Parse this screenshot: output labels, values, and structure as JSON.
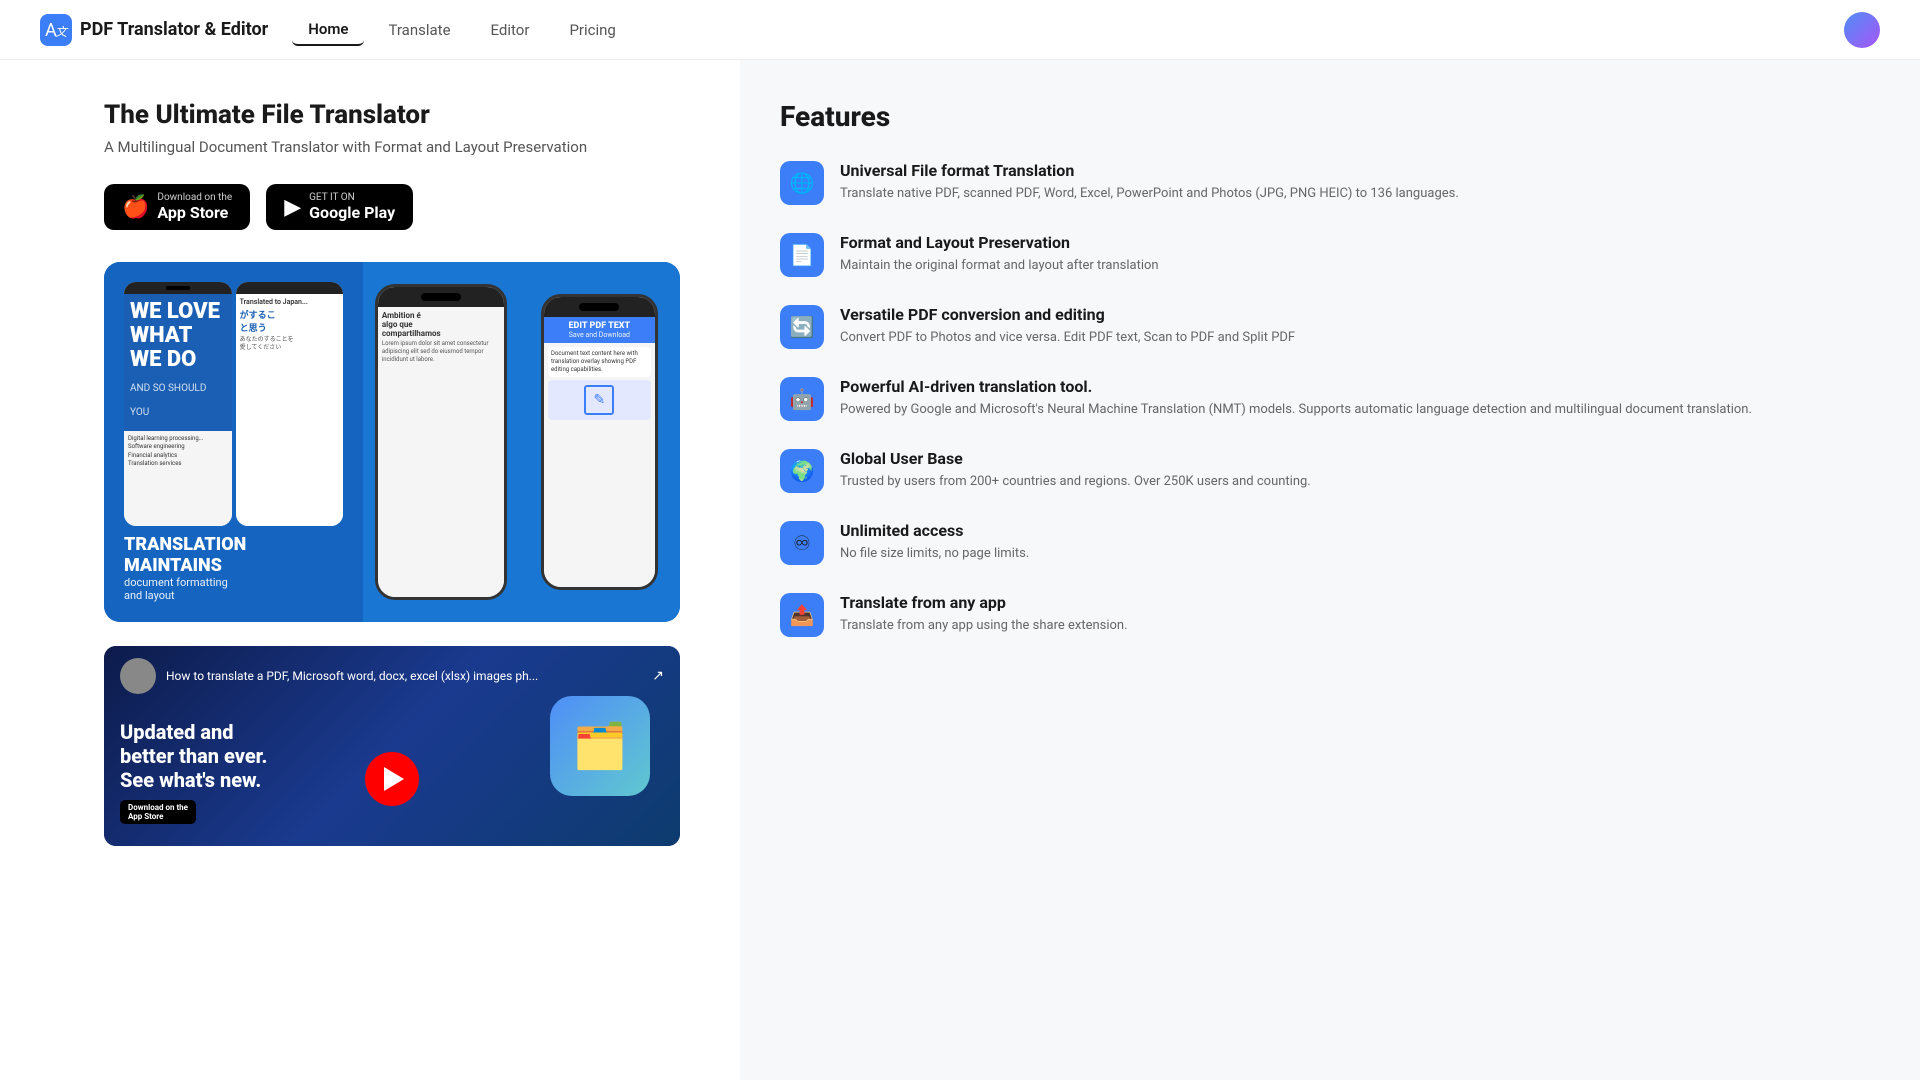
{
  "header": {
    "logo_text": "PDF Translator & Editor",
    "nav": [
      {
        "id": "home",
        "label": "Home",
        "active": true
      },
      {
        "id": "translate",
        "label": "Translate",
        "active": false
      },
      {
        "id": "editor",
        "label": "Editor",
        "active": false
      },
      {
        "id": "pricing",
        "label": "Pricing",
        "active": false
      }
    ]
  },
  "hero": {
    "title": "The Ultimate File Translator",
    "subtitle": "A Multilingual Document Translator with Format and Layout Preservation",
    "app_store_small": "Download on the",
    "app_store_large": "App Store",
    "google_play_small": "GET IT ON",
    "google_play_large": "Google Play"
  },
  "video": {
    "title": "How to translate a PDF, Microsoft word, docx, excel (xlsx) images ph...",
    "main_text": "Updated and\nbetter than\never.\nSee what's new.",
    "download_label": "Download on the\nApp Store",
    "share_icon": "↗"
  },
  "features": {
    "title": "Features",
    "items": [
      {
        "id": "universal",
        "icon": "🌐",
        "name": "Universal File format Translation",
        "desc": "Translate native PDF, scanned PDF, Word, Excel, PowerPoint and Photos (JPG, PNG HEIC) to 136 languages."
      },
      {
        "id": "format",
        "icon": "📄",
        "name": "Format and Layout Preservation",
        "desc": "Maintain the original format and layout after translation"
      },
      {
        "id": "versatile",
        "icon": "🔄",
        "name": "Versatile PDF conversion and editing",
        "desc": "Convert PDF to Photos and vice versa. Edit PDF text, Scan to PDF and Split PDF"
      },
      {
        "id": "ai",
        "icon": "🤖",
        "name": "Powerful AI-driven translation tool.",
        "desc": "Powered by Google and Microsoft's Neural Machine Translation (NMT) models. Supports automatic language detection and multilingual document translation."
      },
      {
        "id": "global",
        "icon": "🌍",
        "name": "Global User Base",
        "desc": "Trusted by users from 200+ countries and regions. Over 250K users and counting."
      },
      {
        "id": "unlimited",
        "icon": "♾",
        "name": "Unlimited access",
        "desc": "No file size limits, no page limits."
      },
      {
        "id": "anyapp",
        "icon": "📤",
        "name": "Translate from any app",
        "desc": "Translate from any app using the share extension."
      }
    ]
  }
}
